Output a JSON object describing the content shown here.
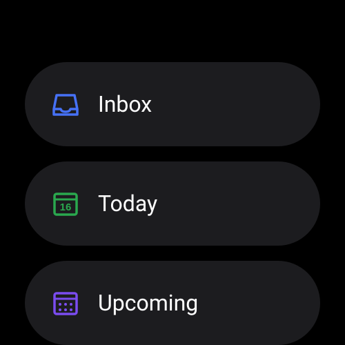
{
  "menu": {
    "items": [
      {
        "label": "Inbox",
        "icon": "inbox-icon",
        "color": "#4671f6"
      },
      {
        "label": "Today",
        "icon": "calendar-today-icon",
        "color": "#2aa84e",
        "day": "16"
      },
      {
        "label": "Upcoming",
        "icon": "calendar-upcoming-icon",
        "color": "#7b4cf0"
      }
    ]
  }
}
